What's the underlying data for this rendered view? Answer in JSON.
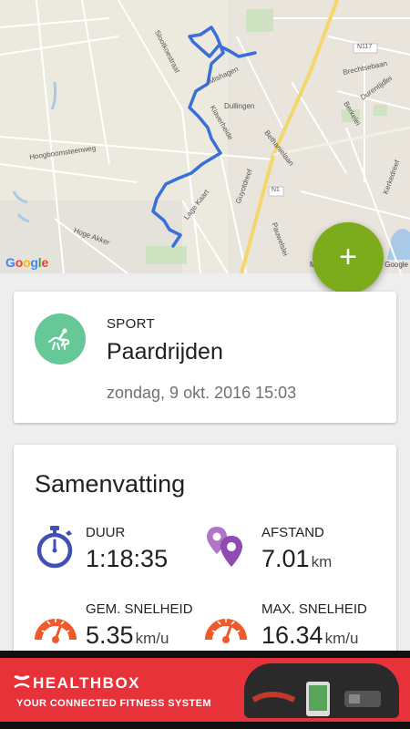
{
  "map": {
    "labels": {
      "street1": "Slootkoestraat",
      "street2": "Hoogboomsteenweg",
      "street3": "Dullingen",
      "street4": "Klaverheide",
      "street5": "Bethanielaan",
      "street6": "Guyotdreef",
      "street7": "Lage Kaart",
      "street8": "Pauwelslei",
      "street9": "Hoge Akker",
      "street10": "Brechtsebaan",
      "street11": "Durentijdlei",
      "street12": "Kerkedreef",
      "street13": "Berkelei",
      "street14": "Mishagen",
      "road1": "N117",
      "road2": "N1"
    },
    "google_letters": [
      "G",
      "o",
      "o",
      "g",
      "l",
      "e"
    ],
    "credit": "Google",
    "credit_left": "M"
  },
  "fab": {
    "icon": "plus-icon",
    "label": "+"
  },
  "activity": {
    "category_label": "SPORT",
    "name": "Paardrijden",
    "datetime": "zondag, 9 okt. 2016 15:03",
    "icon": "horse-riding-icon",
    "icon_bg": "#66c897"
  },
  "summary": {
    "title": "Samenvatting",
    "duration": {
      "label": "DUUR",
      "value": "1:18:35",
      "icon": "stopwatch-icon"
    },
    "distance": {
      "label": "AFSTAND",
      "value": "7.01",
      "unit": "km",
      "icon": "location-pins-icon"
    },
    "avg_speed": {
      "label": "GEM. SNELHEID",
      "value": "5.35",
      "unit": "km/u",
      "icon": "speedometer-icon"
    },
    "max_speed": {
      "label": "MAX. SNELHEID",
      "value": "16.34",
      "unit": "km/u",
      "icon": "speedometer-icon"
    }
  },
  "ad": {
    "brand": "HEALTHBOX",
    "tagline": "YOUR CONNECTED FITNESS SYSTEM",
    "color": "#e8323a"
  },
  "colors": {
    "accent": "#7cab1b",
    "route": "#3b6fd8",
    "stopwatch": "#3f51b5",
    "distance": "#8e4bb0",
    "speedometer": "#f1592a"
  }
}
